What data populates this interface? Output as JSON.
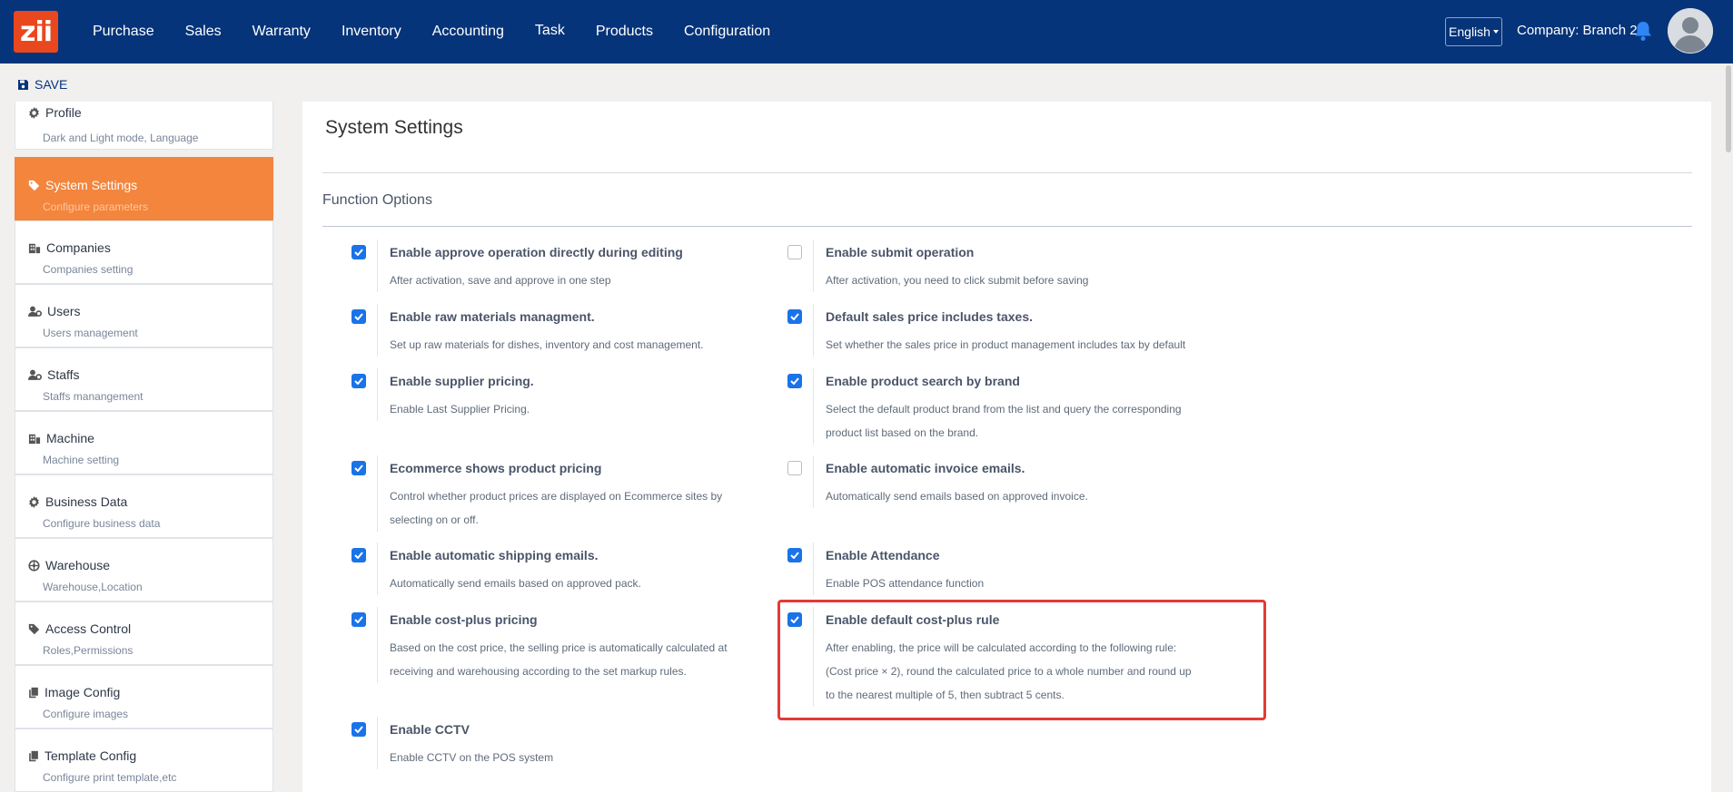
{
  "navbar": {
    "logo_text": "zii",
    "menu": [
      "Purchase",
      "Sales",
      "Warranty",
      "Inventory",
      "Accounting",
      "Task",
      "Products",
      "Configuration"
    ],
    "language": "English",
    "company": "Company: Branch 2"
  },
  "toolbar": {
    "save_label": "SAVE"
  },
  "sidebar": {
    "items": [
      {
        "icon": "gear-icon",
        "title": "Profile",
        "sub": "Dark and Light mode, Language"
      },
      {
        "icon": "tag-icon",
        "title": "System Settings",
        "sub": "Configure parameters",
        "active": true
      },
      {
        "icon": "building-icon",
        "title": "Companies",
        "sub": "Companies setting"
      },
      {
        "icon": "user-gear-icon",
        "title": "Users",
        "sub": "Users management"
      },
      {
        "icon": "user-gear-icon",
        "title": "Staffs",
        "sub": "Staffs manangement"
      },
      {
        "icon": "building-icon",
        "title": "Machine",
        "sub": "Machine setting"
      },
      {
        "icon": "gear-icon",
        "title": "Business Data",
        "sub": "Configure business data"
      },
      {
        "icon": "warehouse-icon",
        "title": "Warehouse",
        "sub": "Warehouse,Location"
      },
      {
        "icon": "tag-icon",
        "title": "Access Control",
        "sub": "Roles,Permissions"
      },
      {
        "icon": "copy-icon",
        "title": "Image Config",
        "sub": "Configure images"
      },
      {
        "icon": "copy-icon",
        "title": "Template Config",
        "sub": "Configure print template,etc"
      }
    ]
  },
  "main": {
    "title": "System Settings",
    "section": "Function Options",
    "options": [
      {
        "label": "Enable approve operation directly during editing",
        "desc": "After activation, save and approve in one step",
        "checked": true
      },
      {
        "label": "Enable submit operation",
        "desc": "After activation, you need to click submit before saving",
        "checked": false
      },
      {
        "label": "Enable raw materials managment.",
        "desc": "Set up raw materials for dishes, inventory and cost management.",
        "checked": true
      },
      {
        "label": "Default sales price includes taxes.",
        "desc": "Set whether the sales price in product management includes tax by default",
        "checked": true
      },
      {
        "label": "Enable supplier pricing.",
        "desc": "Enable Last Supplier Pricing.",
        "checked": true
      },
      {
        "label": "Enable product search by brand",
        "desc": "Select the default product brand from the list and query the corresponding product list based on the brand.",
        "checked": true
      },
      {
        "label": "Ecommerce shows product pricing",
        "desc": "Control whether product prices are displayed on Ecommerce sites by selecting on or off.",
        "checked": true
      },
      {
        "label": "Enable automatic invoice emails.",
        "desc": "Automatically send emails based on approved invoice.",
        "checked": false
      },
      {
        "label": "Enable automatic shipping emails.",
        "desc": "Automatically send emails based on approved pack.",
        "checked": true
      },
      {
        "label": "Enable Attendance",
        "desc": "Enable POS attendance function",
        "checked": true
      },
      {
        "label": "Enable cost-plus pricing",
        "desc": "Based on the cost price, the selling price is automatically calculated at receiving and warehousing according to the set markup rules.",
        "checked": true
      },
      {
        "label": "Enable default cost-plus rule",
        "desc": "After enabling, the price will be calculated according to the following rule: (Cost price × 2), round the calculated price to a whole number and round up to the nearest multiple of 5, then subtract 5 cents.",
        "checked": true
      },
      {
        "label": "Enable CCTV",
        "desc": "Enable CCTV on the POS system",
        "checked": true
      }
    ]
  },
  "colors": {
    "navbar": "#06347a",
    "active": "#f3853d",
    "checkbox": "#1a73e8",
    "highlight": "#e53935"
  }
}
